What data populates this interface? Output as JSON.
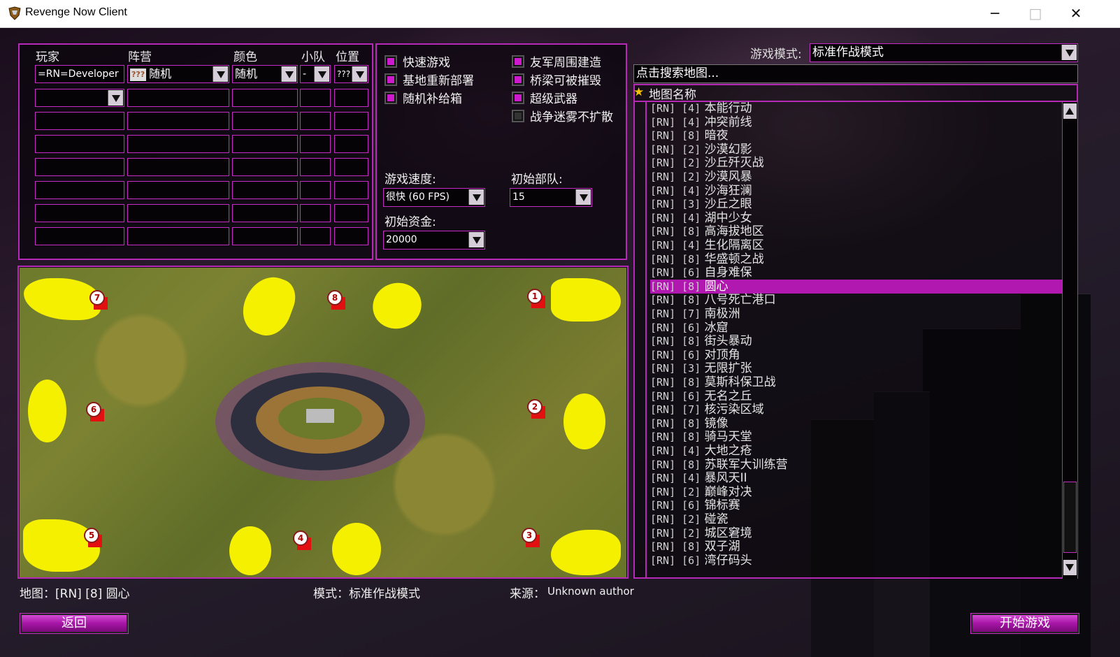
{
  "window": {
    "title": "Revenge Now Client",
    "controls": [
      "─",
      "□",
      "✕"
    ]
  },
  "players": {
    "headers": {
      "player": "玩家",
      "faction": "阵营",
      "color": "颜色",
      "team": "小队",
      "position": "位置"
    },
    "row1": {
      "name": "=RN=Developer",
      "faction_icon": "???",
      "faction": "随机",
      "color": "随机",
      "team": "-",
      "position": "???"
    }
  },
  "options": {
    "quick_game": "快速游戏",
    "base_redeploy": "基地重新部署",
    "random_crates": "随机补给箱",
    "ally_build": "友军周围建造",
    "bridges_destroyable": "桥梁可被摧毁",
    "superweapons": "超级武器",
    "fog_no_spread": "战争迷雾不扩散",
    "game_speed_label": "游戏速度:",
    "game_speed_value": "很快 (60 FPS)",
    "start_units_label": "初始部队:",
    "start_units_value": "15",
    "start_money_label": "初始资金:",
    "start_money_value": "20000"
  },
  "map_list": {
    "mode_label": "游戏模式:",
    "mode_value": "标准作战模式",
    "search_placeholder": "点击搜索地图...",
    "column_header": "地图名称",
    "star": "★",
    "selected_index": 13,
    "items": [
      {
        "tag": "[RN] [4]",
        "name": "本能行动"
      },
      {
        "tag": "[RN] [4]",
        "name": "冲突前线"
      },
      {
        "tag": "[RN] [8]",
        "name": "暗夜"
      },
      {
        "tag": "[RN] [2]",
        "name": "沙漠幻影"
      },
      {
        "tag": "[RN] [2]",
        "name": "沙丘歼灭战"
      },
      {
        "tag": "[RN] [2]",
        "name": "沙漠风暴"
      },
      {
        "tag": "[RN] [4]",
        "name": "沙海狂澜"
      },
      {
        "tag": "[RN] [3]",
        "name": "沙丘之眼"
      },
      {
        "tag": "[RN] [4]",
        "name": "湖中少女"
      },
      {
        "tag": "[RN] [8]",
        "name": "高海拔地区"
      },
      {
        "tag": "[RN] [4]",
        "name": "生化隔离区"
      },
      {
        "tag": "[RN] [8]",
        "name": "华盛顿之战"
      },
      {
        "tag": "[RN] [6]",
        "name": "自身难保"
      },
      {
        "tag": "[RN] [8]",
        "name": "圆心"
      },
      {
        "tag": "[RN] [8]",
        "name": "八号死亡港口"
      },
      {
        "tag": "[RN] [7]",
        "name": "南极洲"
      },
      {
        "tag": "[RN] [6]",
        "name": "冰窟"
      },
      {
        "tag": "[RN] [8]",
        "name": "街头暴动"
      },
      {
        "tag": "[RN] [6]",
        "name": "对顶角"
      },
      {
        "tag": "[RN] [3]",
        "name": "无限扩张"
      },
      {
        "tag": "[RN] [8]",
        "name": "莫斯科保卫战"
      },
      {
        "tag": "[RN] [6]",
        "name": "无名之丘"
      },
      {
        "tag": "[RN] [7]",
        "name": "核污染区域"
      },
      {
        "tag": "[RN] [8]",
        "name": "镜像"
      },
      {
        "tag": "[RN] [8]",
        "name": "骑马天堂"
      },
      {
        "tag": "[RN] [4]",
        "name": "大地之疮"
      },
      {
        "tag": "[RN] [8]",
        "name": "苏联军大训练营"
      },
      {
        "tag": "[RN] [4]",
        "name": "暴风天II"
      },
      {
        "tag": "[RN] [2]",
        "name": "巅峰对决"
      },
      {
        "tag": "[RN] [6]",
        "name": "锦标赛"
      },
      {
        "tag": "[RN] [2]",
        "name": "碰瓷"
      },
      {
        "tag": "[RN] [2]",
        "name": "城区窘境"
      },
      {
        "tag": "[RN] [8]",
        "name": "双子湖"
      },
      {
        "tag": "[RN] [6]",
        "name": "湾仔码头"
      }
    ]
  },
  "preview": {
    "start_positions": [
      "1",
      "2",
      "3",
      "4",
      "5",
      "6",
      "7",
      "8"
    ]
  },
  "footer": {
    "map_info": "地图：[RN] [8] 圆心",
    "mode_info": "模式：标准作战模式",
    "source_label": "来源：",
    "source_value": "Unknown author",
    "back_button": "返回",
    "start_button": "开始游戏"
  }
}
